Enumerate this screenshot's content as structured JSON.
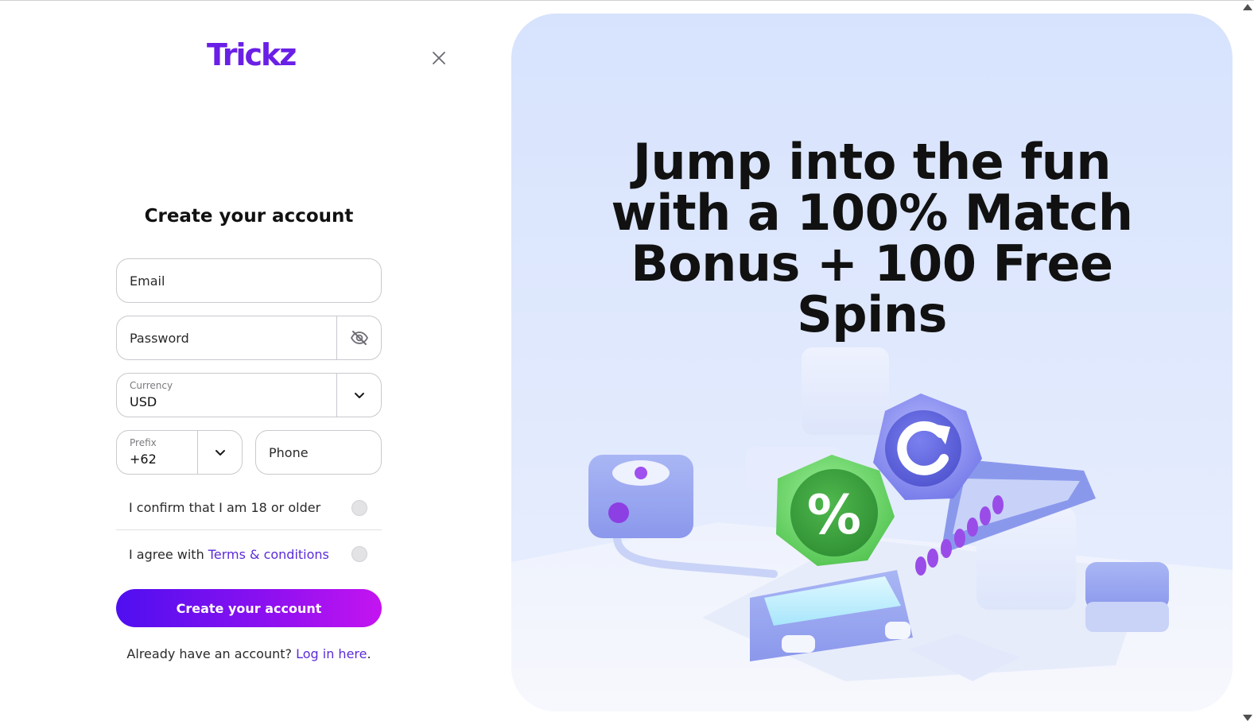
{
  "brand": {
    "logo_text": "Trickz",
    "accent": "#6a1fe6"
  },
  "form": {
    "title": "Create your account",
    "email_placeholder": "Email",
    "password_placeholder": "Password",
    "currency": {
      "label": "Currency",
      "value": "USD"
    },
    "prefix": {
      "label": "Prefix",
      "value": "+62"
    },
    "phone_placeholder": "Phone",
    "age_confirm_label": "I confirm that I am 18 or older",
    "terms_prefix": "I agree with ",
    "terms_link": "Terms & conditions",
    "submit_label": "Create your account",
    "login_prompt": "Already have an account? ",
    "login_link": "Log in here",
    "login_suffix": "."
  },
  "hero": {
    "title_lines": [
      "Jump into the fun",
      "with a 100% Match",
      "Bonus + 100 Free",
      "Spins"
    ],
    "badge_percent": "%"
  },
  "icons": {
    "close": "close-icon",
    "password_toggle": "eye-off-icon",
    "currency_dropdown": "chevron-down-icon",
    "prefix_dropdown": "chevron-down-icon",
    "scroll_up": "arrow-up-icon",
    "scroll_down": "arrow-down-icon"
  },
  "colors": {
    "cta_gradient_start": "#4f0ff0",
    "cta_gradient_end": "#c414f0",
    "link": "#5b2bd8",
    "hero_background": "#d7e3fd",
    "percent_badge": "#4cc04a",
    "refresh_badge": "#6f74e8"
  }
}
